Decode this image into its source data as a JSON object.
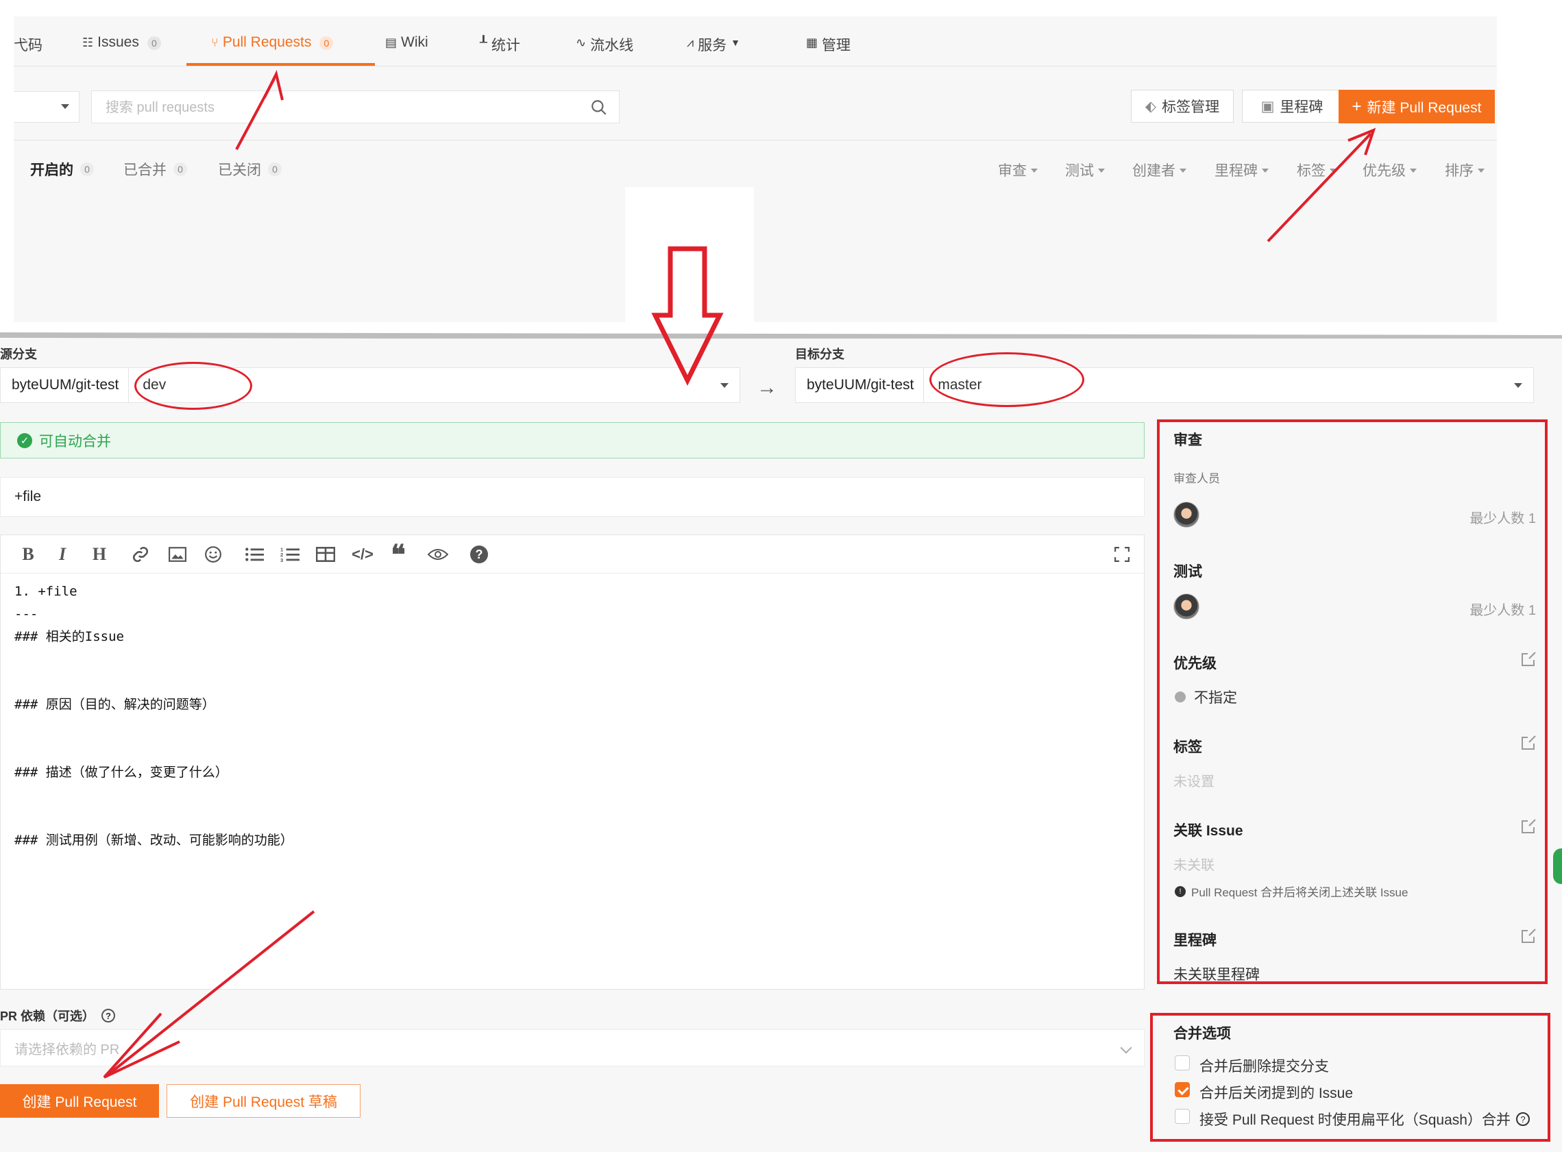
{
  "tabs": [
    {
      "label": "弋码",
      "icon": "code-icon"
    },
    {
      "label": "Issues",
      "count": "0",
      "icon": "issues-icon"
    },
    {
      "label": "Pull Requests",
      "count": "0",
      "icon": "pull-request-icon"
    },
    {
      "label": "Wiki",
      "icon": "wiki-icon"
    },
    {
      "label": "统计",
      "icon": "chart-icon"
    },
    {
      "label": "流水线",
      "icon": "pipeline-icon"
    },
    {
      "label": "服务",
      "icon": "pulse-icon"
    },
    {
      "label": "管理",
      "icon": "manage-icon"
    }
  ],
  "search": {
    "placeholder": "搜索 pull requests"
  },
  "toolbar": {
    "labels_btn": "标签管理",
    "milestones_btn": "里程碑",
    "new_pr_btn": "新建 Pull Request"
  },
  "states": [
    {
      "label": "开启的",
      "count": "0"
    },
    {
      "label": "已合并",
      "count": "0"
    },
    {
      "label": "已关闭",
      "count": "0"
    }
  ],
  "filters": [
    "审查",
    "测试",
    "创建者",
    "里程碑",
    "标签",
    "优先级",
    "排序"
  ],
  "branches": {
    "source_label": "源分支",
    "source_repo": "byteUUM/git-test",
    "source_branch": "dev",
    "target_label": "目标分支",
    "target_repo": "byteUUM/git-test",
    "target_branch": "master",
    "arrow": "→"
  },
  "auto_merge": "可自动合并",
  "pr_title": "+file",
  "editor_lines": [
    "1. +file",
    "---",
    "### 相关的Issue",
    "",
    "",
    "### 原因（目的、解决的问题等）",
    "",
    "",
    "### 描述（做了什么，变更了什么）",
    "",
    "",
    "### 测试用例（新增、改动、可能影响的功能）"
  ],
  "dependency": {
    "label": "PR 依赖（可选）",
    "placeholder": "请选择依赖的 PR"
  },
  "actions": {
    "create": "创建 Pull Request",
    "draft": "创建 Pull Request 草稿"
  },
  "sidebar": {
    "review": {
      "title": "审查",
      "sub": "审查人员",
      "min": "最少人数 1"
    },
    "test": {
      "title": "测试",
      "min": "最少人数 1"
    },
    "priority": {
      "title": "优先级",
      "value": "不指定"
    },
    "labels": {
      "title": "标签",
      "value": "未设置"
    },
    "issue": {
      "title": "关联 Issue",
      "value": "未关联",
      "note": "Pull Request 合并后将关闭上述关联 Issue"
    },
    "milestone": {
      "title": "里程碑",
      "value": "未关联里程碑"
    },
    "merge": {
      "title": "合并选项",
      "options": [
        {
          "label": "合并后删除提交分支",
          "checked": false
        },
        {
          "label": "合并后关闭提到的 Issue",
          "checked": true
        },
        {
          "label": "接受 Pull Request 时使用扁平化（Squash）合并",
          "checked": false
        }
      ]
    }
  },
  "colors": {
    "accent": "#f5701d",
    "success": "#2ea54f",
    "annotation": "#e0202a"
  }
}
